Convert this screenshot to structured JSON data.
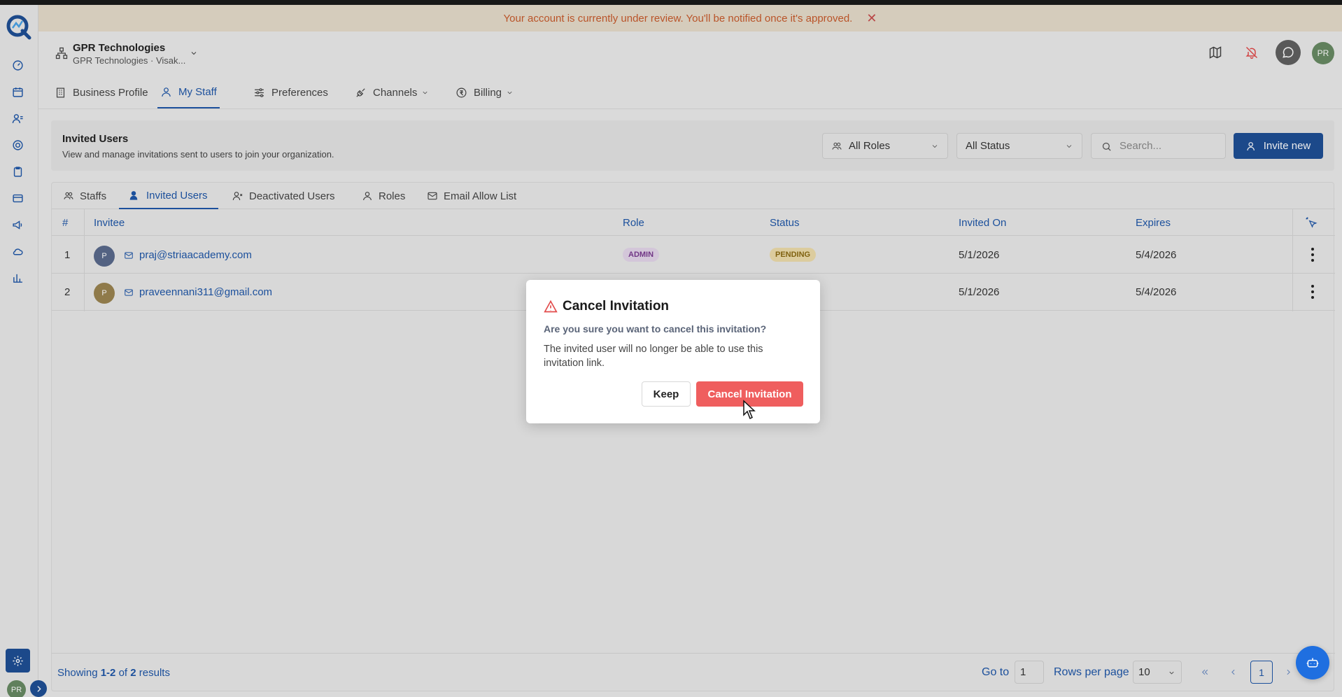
{
  "banner": {
    "message": "Your account is currently under review. You'll be notified once it's approved.",
    "close_icon": "close-icon",
    "colors": {
      "background": "#e6dccb",
      "text": "#c85b2d"
    }
  },
  "sidebar": {
    "items": [
      {
        "icon": "dashboard-icon"
      },
      {
        "icon": "calendar-icon"
      },
      {
        "icon": "contacts-icon"
      },
      {
        "icon": "target-icon"
      },
      {
        "icon": "clipboard-icon"
      },
      {
        "icon": "card-icon"
      },
      {
        "icon": "megaphone-icon"
      },
      {
        "icon": "cloud-icon"
      },
      {
        "icon": "chart-icon"
      }
    ],
    "settings_icon": "gear-icon",
    "avatar_initials": "PR"
  },
  "header": {
    "org_name": "GPR Technologies",
    "org_sub": "GPR Technologies · Visak...",
    "avatar_initials": "PR",
    "icons": [
      "map-icon",
      "bell-off-icon",
      "whatsapp-icon"
    ]
  },
  "nav": {
    "tabs": [
      {
        "label": "Business Profile"
      },
      {
        "label": "My Staff",
        "active": true
      },
      {
        "label": "Preferences"
      },
      {
        "label": "Channels"
      },
      {
        "label": "Billing"
      }
    ]
  },
  "panel": {
    "title": "Invited Users",
    "subtitle": "View and manage invitations sent to users to join your organization.",
    "roles_filter": "All Roles",
    "status_filter": "All Status",
    "search_placeholder": "Search...",
    "invite_label": "Invite new"
  },
  "subtabs": [
    {
      "label": "Staffs"
    },
    {
      "label": "Invited Users",
      "active": true
    },
    {
      "label": "Deactivated Users"
    },
    {
      "label": "Roles"
    },
    {
      "label": "Email Allow List"
    }
  ],
  "table": {
    "headers": {
      "num": "#",
      "invitee": "Invitee",
      "role": "Role",
      "status": "Status",
      "invited_on": "Invited On",
      "expires": "Expires"
    },
    "rows": [
      {
        "num": "1",
        "avatar": "P",
        "email": "praj@striaacademy.com",
        "role": "ADMIN",
        "status": "PENDING",
        "invited_on": "5/1/2026",
        "expires": "5/4/2026",
        "avatar_color": "#5a6a8c"
      },
      {
        "num": "2",
        "avatar": "P",
        "email": "praveennani311@gmail.com",
        "role": "",
        "status": "",
        "invited_on": "5/1/2026",
        "expires": "5/4/2026",
        "avatar_color": "#9a8450"
      }
    ]
  },
  "footer": {
    "showing_prefix": "Showing ",
    "showing_range": "1-2",
    "showing_of": " of ",
    "showing_total": "2",
    "showing_suffix": " results",
    "goto_label": "Go to",
    "goto_value": "1",
    "rows_per_page_label": "Rows per page",
    "rows_per_page_value": "10",
    "current_page": "1"
  },
  "modal": {
    "title": "Cancel Invitation",
    "question": "Are you sure you want to cancel this invitation?",
    "body": "The invited user will no longer be able to use this invitation link.",
    "keep_label": "Keep",
    "confirm_label": "Cancel Invitation",
    "colors": {
      "danger": "#ef5e5e"
    }
  },
  "colors": {
    "accent": "#1f57a8",
    "primary_button": "#1f4f95"
  }
}
